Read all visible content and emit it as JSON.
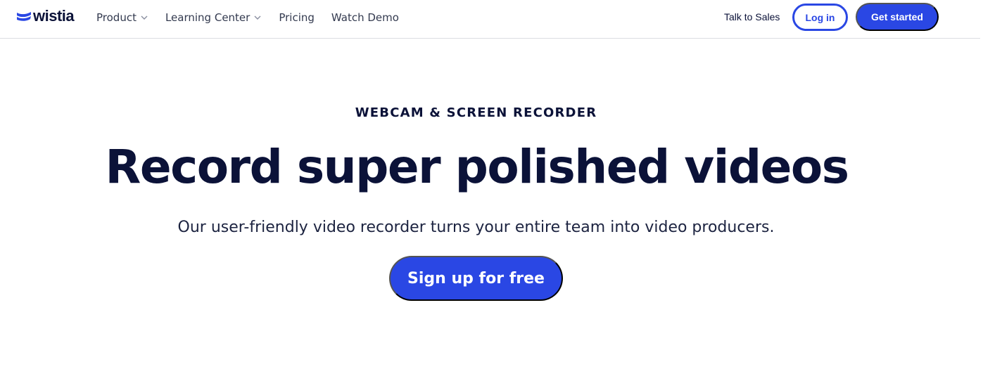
{
  "header": {
    "logo": {
      "text": "wistia",
      "icon": "wistia-logo-icon",
      "color": "#2a47e4"
    },
    "nav": [
      {
        "label": "Product",
        "has_dropdown": true
      },
      {
        "label": "Learning Center",
        "has_dropdown": true
      },
      {
        "label": "Pricing",
        "has_dropdown": false
      },
      {
        "label": "Watch Demo",
        "has_dropdown": false
      }
    ],
    "talk_to_sales": "Talk to Sales",
    "login_label": "Log in",
    "get_started_label": "Get started"
  },
  "hero": {
    "eyebrow": "WEBCAM & SCREEN RECORDER",
    "headline": "Record super polished videos",
    "subhead": "Our user-friendly video recorder turns your entire team into video producers.",
    "cta_label": "Sign up for free"
  },
  "colors": {
    "brand_blue": "#2a47e4",
    "navy_text": "#0b1238",
    "divider": "#dcdde2"
  }
}
